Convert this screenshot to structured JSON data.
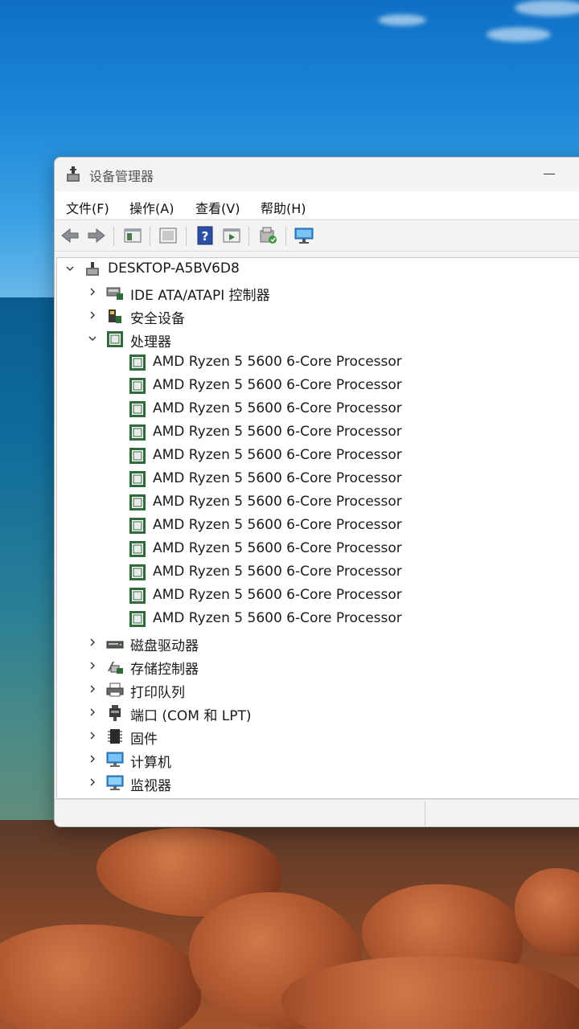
{
  "window": {
    "title": "设备管理器",
    "menu": [
      "文件(F)",
      "操作(A)",
      "查看(V)",
      "帮助(H)"
    ]
  },
  "toolbar": {
    "icons": [
      "back-arrow-icon",
      "forward-arrow-icon",
      "show-hide-tree-icon",
      "properties-icon",
      "help-icon",
      "run-icon",
      "update-driver-icon",
      "scan-hardware-icon"
    ]
  },
  "tree": {
    "root": "DESKTOP-A5BV6D8",
    "categories": [
      {
        "label": "IDE ATA/ATAPI 控制器",
        "expanded": false
      },
      {
        "label": "安全设备",
        "expanded": false
      },
      {
        "label": "处理器",
        "expanded": true
      },
      {
        "label": "磁盘驱动器",
        "expanded": false
      },
      {
        "label": "存储控制器",
        "expanded": false
      },
      {
        "label": "打印队列",
        "expanded": false
      },
      {
        "label": "端口 (COM 和 LPT)",
        "expanded": false
      },
      {
        "label": "固件",
        "expanded": false
      },
      {
        "label": "计算机",
        "expanded": false
      },
      {
        "label": "监视器",
        "expanded": false
      }
    ],
    "processors": [
      "AMD Ryzen 5 5600 6-Core Processor",
      "AMD Ryzen 5 5600 6-Core Processor",
      "AMD Ryzen 5 5600 6-Core Processor",
      "AMD Ryzen 5 5600 6-Core Processor",
      "AMD Ryzen 5 5600 6-Core Processor",
      "AMD Ryzen 5 5600 6-Core Processor",
      "AMD Ryzen 5 5600 6-Core Processor",
      "AMD Ryzen 5 5600 6-Core Processor",
      "AMD Ryzen 5 5600 6-Core Processor",
      "AMD Ryzen 5 5600 6-Core Processor",
      "AMD Ryzen 5 5600 6-Core Processor",
      "AMD Ryzen 5 5600 6-Core Processor"
    ]
  },
  "colors": {
    "processor_icon": "#2f6b3a",
    "sky": "#1b86d8",
    "sea": "#0f6c9c"
  }
}
